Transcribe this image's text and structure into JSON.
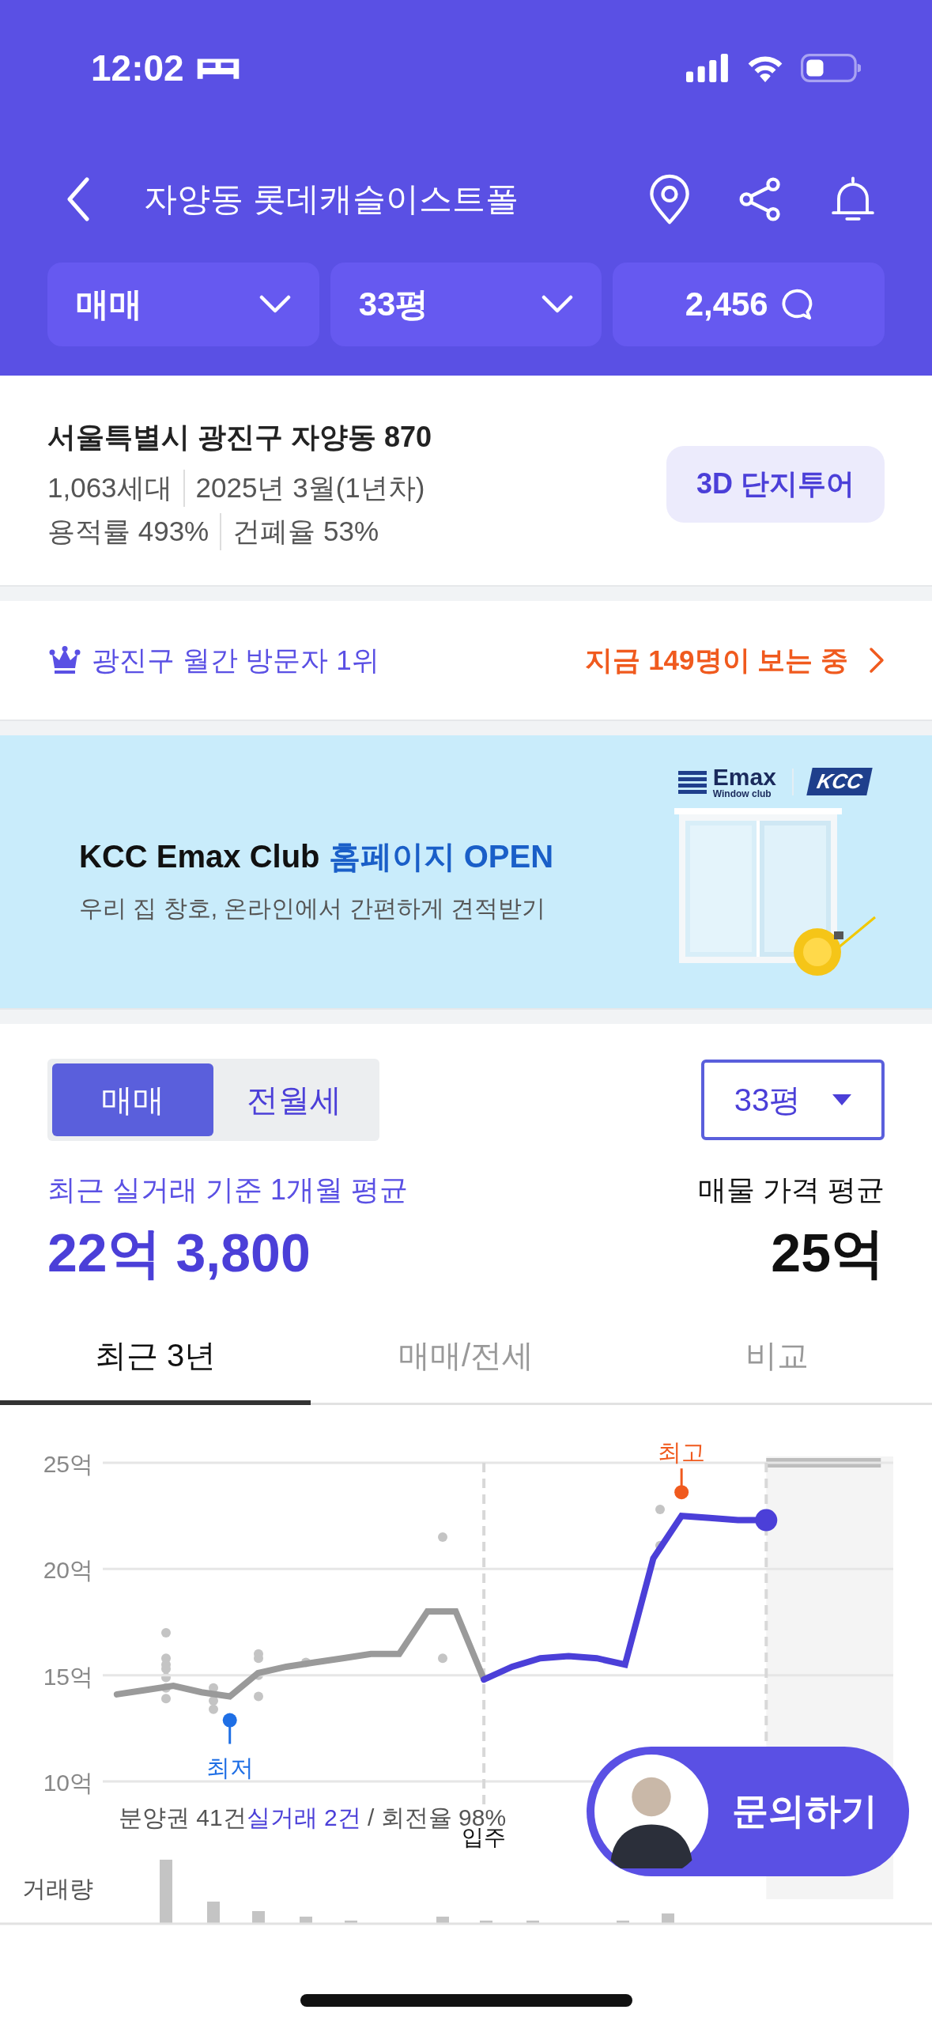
{
  "status_bar": {
    "time": "12:02"
  },
  "header": {
    "title": "자양동 롯데캐슬이스트폴"
  },
  "filters": [
    {
      "label": "매매",
      "kind": "dropdown"
    },
    {
      "label": "33평",
      "kind": "dropdown"
    },
    {
      "label": "2,456",
      "kind": "comments"
    }
  ],
  "complex": {
    "address": "서울특별시 광진구 자양동 870",
    "details": [
      [
        "1,063세대",
        "2025년 3월(1년차)"
      ],
      [
        "용적률 493%",
        "건폐율 53%"
      ]
    ],
    "tour_button": "3D 단지투어"
  },
  "ranking": {
    "text": "광진구 월간 방문자 1위",
    "viewers": "지금 149명이 보는 중"
  },
  "banner": {
    "brand": "Emax",
    "brand_sub": "Window club",
    "partner": "KCC",
    "title": "KCC Emax Club",
    "title_highlight": "홈페이지 OPEN",
    "subtitle": "우리 집 창호, 온라인에서 간편하게 견적받기"
  },
  "price": {
    "segments": [
      {
        "label": "매매",
        "selected": true
      },
      {
        "label": "전월세",
        "selected": false
      }
    ],
    "size": "33평",
    "recent_label": "최근 실거래 기준 1개월 평균",
    "recent_value": "22억 3,800",
    "listing_label": "매물 가격 평균",
    "listing_value": "25억"
  },
  "tabs": [
    {
      "label": "최근 3년",
      "selected": true
    },
    {
      "label": "매매/전세",
      "selected": false
    },
    {
      "label": "비교",
      "selected": false
    }
  ],
  "chart": {
    "chart_data": {
      "type": "line",
      "categories": [
        null,
        null,
        null,
        null,
        null,
        null,
        null,
        null,
        null,
        null,
        null,
        null,
        null,
        null,
        null,
        null,
        null,
        null,
        null,
        null,
        null,
        null,
        null,
        null,
        null,
        null,
        null,
        null
      ],
      "ylim": [
        10,
        25
      ],
      "grid": true,
      "yticks": [
        {
          "value": 10,
          "label": "10억"
        },
        {
          "value": 15,
          "label": "15억"
        },
        {
          "value": 20,
          "label": "20억"
        },
        {
          "value": 25,
          "label": "25억"
        }
      ],
      "series": [
        {
          "color": "#9a9a9a",
          "values": [
            14.1,
            14.3,
            14.5,
            14.2,
            14.0,
            15.1,
            15.4,
            15.6,
            15.8,
            16.0,
            16.0,
            18.0,
            18.0,
            14.8,
            null,
            null,
            null,
            null,
            null,
            null,
            null,
            null,
            null,
            null,
            null,
            null,
            null,
            null
          ]
        },
        {
          "color": "#4b3fd8",
          "values": [
            null,
            null,
            null,
            null,
            null,
            null,
            null,
            null,
            null,
            null,
            null,
            null,
            null,
            14.8,
            15.4,
            15.8,
            15.9,
            15.8,
            15.5,
            20.5,
            22.5,
            22.4,
            22.3,
            22.3,
            null,
            null,
            null,
            null
          ]
        }
      ]
    },
    "markers": [
      {
        "kind": "min",
        "label": "최저",
        "color": "#1f6fe5"
      },
      {
        "kind": "max",
        "label": "최고",
        "color": "#f05a1e"
      }
    ],
    "move_in_label": "입주",
    "summary": {
      "text": "분양권 41건",
      "highlight": "실거래 2건",
      "rest": " / 회전율 98%"
    },
    "volume_label": "거래량"
  },
  "inquiry_button": "문의하기"
}
